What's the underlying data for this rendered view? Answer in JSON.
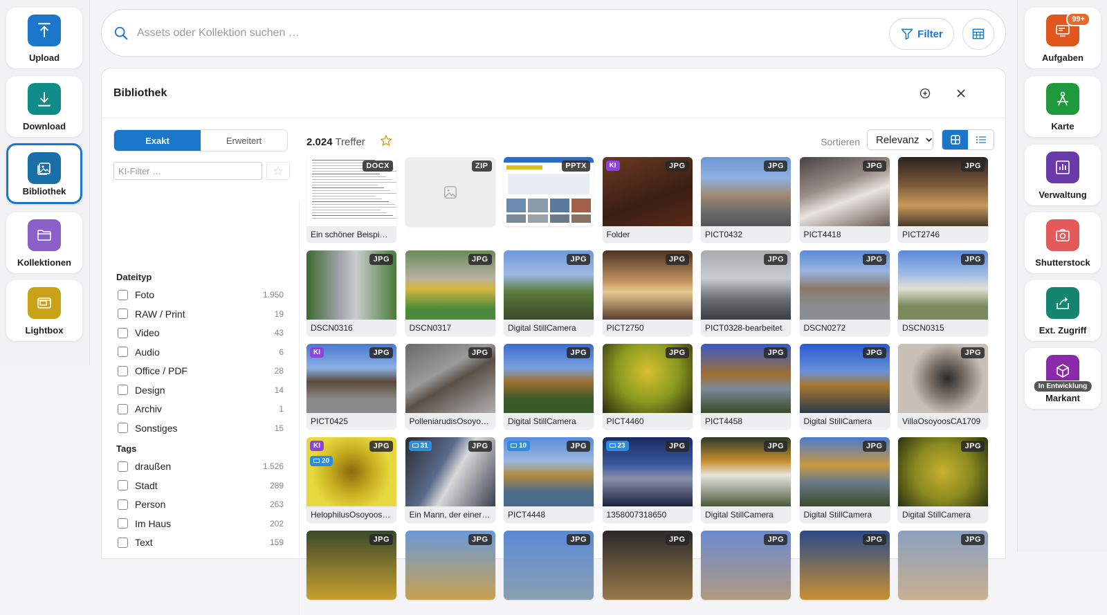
{
  "left_rail": [
    {
      "label": "Upload",
      "icon": "upload-icon",
      "color": "#1a76c9"
    },
    {
      "label": "Download",
      "icon": "download-icon",
      "color": "#0f8b8a"
    },
    {
      "label": "Bibliothek",
      "icon": "library-icon",
      "color": "#1a6fa8",
      "active": true
    },
    {
      "label": "Kollektionen",
      "icon": "folder-icon",
      "color": "#8b5fc7"
    },
    {
      "label": "Lightbox",
      "icon": "lightbox-icon",
      "color": "#c9a317"
    }
  ],
  "right_rail": [
    {
      "label": "Aufgaben",
      "icon": "tasks-icon",
      "color": "#e0561c",
      "badge": "99+"
    },
    {
      "label": "Karte",
      "icon": "map-icon",
      "color": "#1e9a3c"
    },
    {
      "label": "Verwaltung",
      "icon": "chart-icon",
      "color": "#6a3aa8"
    },
    {
      "label": "Shutterstock",
      "icon": "camera-icon",
      "color": "#e45a5a"
    },
    {
      "label": "Ext. Zugriff",
      "icon": "share-icon",
      "color": "#14856e"
    },
    {
      "label": "Markant",
      "icon": "cube-icon",
      "color": "#8a2aa8",
      "badge": "In Entwicklung"
    }
  ],
  "search": {
    "placeholder": "Assets oder Kollektion suchen …",
    "filter_label": "Filter"
  },
  "panel": {
    "title": "Bibliothek"
  },
  "filter": {
    "mode_exact": "Exakt",
    "mode_extended": "Erweitert",
    "ki_placeholder": "KI-Filter …",
    "filetype_title": "Dateityp",
    "filetypes": [
      {
        "label": "Foto",
        "count": "1.950"
      },
      {
        "label": "RAW / Print",
        "count": "19"
      },
      {
        "label": "Video",
        "count": "43"
      },
      {
        "label": "Audio",
        "count": "6"
      },
      {
        "label": "Office / PDF",
        "count": "28"
      },
      {
        "label": "Design",
        "count": "14"
      },
      {
        "label": "Archiv",
        "count": "1"
      },
      {
        "label": "Sonstiges",
        "count": "15"
      }
    ],
    "tags_title": "Tags",
    "tags": [
      {
        "label": "draußen",
        "count": "1.526"
      },
      {
        "label": "Stadt",
        "count": "289"
      },
      {
        "label": "Person",
        "count": "263"
      },
      {
        "label": "Im Haus",
        "count": "202"
      },
      {
        "label": "Text",
        "count": "159"
      }
    ]
  },
  "results": {
    "count": "2.024",
    "label": "Treffer",
    "sort_label": "Sortieren",
    "sort_value": "Relevanz"
  },
  "assets": [
    {
      "name": "Ein schöner Beispie…",
      "type": "DOCX",
      "bg": "doc"
    },
    {
      "name": "",
      "type": "ZIP",
      "bg": "zip"
    },
    {
      "name": "",
      "type": "PPTX",
      "bg": "pptx"
    },
    {
      "name": "Folder",
      "type": "JPG",
      "bg": "linear-gradient(160deg,#6b3a22,#3a1f14 60%,#5a2a1a)",
      "ki": "KI"
    },
    {
      "name": "PICT0432",
      "type": "JPG",
      "bg": "linear-gradient(180deg,#6d96d4 0%,#8fb0e0 30%,#a08a70 55%,#6a6a6a 80%,#555 100%)"
    },
    {
      "name": "PICT4418",
      "type": "JPG",
      "bg": "linear-gradient(160deg,#4a4244,#9a8e88 40%,#e8e4e0 60%,#6a5a54)"
    },
    {
      "name": "PICT2746",
      "type": "JPG",
      "bg": "linear-gradient(180deg,#2a2220,#7a5a3a 40%,#c89a5a 70%,#4a3a2a)"
    },
    {
      "name": "DSCN0316",
      "type": "JPG",
      "bg": "linear-gradient(90deg,#3e6a2e,#9aa0a4 35%,#c8ccce 55%,#4a7a3a)"
    },
    {
      "name": "DSCN0317",
      "type": "JPG",
      "bg": "linear-gradient(180deg,#6a8a5a,#b8b0a0 40%,#d4b840 55%,#4a8a3a 85%)"
    },
    {
      "name": "Digital StillCamera",
      "type": "JPG",
      "bg": "linear-gradient(180deg,#6e9ad8,#9ab8e0 35%,#5a7a3a 60%,#3a4a2a)"
    },
    {
      "name": "PICT2750",
      "type": "JPG",
      "bg": "linear-gradient(180deg,#4a3424,#c49460 45%,#e8c890 60%,#5a4030)"
    },
    {
      "name": "PICT0328-bearbeitet",
      "type": "JPG",
      "bg": "linear-gradient(180deg,#a8acb0,#c8ccd0 40%,#6a6e72 70%,#3a3e42)"
    },
    {
      "name": "DSCN0272",
      "type": "JPG",
      "bg": "linear-gradient(180deg,#5a8ad8,#9ab4e0 30%,#8a7a6a 55%,#8a8e90 80%)"
    },
    {
      "name": "DSCN0315",
      "type": "JPG",
      "bg": "linear-gradient(180deg,#5a8ad8,#a0bce4 35%,#e4e0d8 55%,#7a8a5a 80%)"
    },
    {
      "name": "PICT0425",
      "type": "JPG",
      "bg": "linear-gradient(180deg,#4a7ad0,#8ab0e4 35%,#5a4a3a 55%,#8a8a8a 80%)",
      "ki": "KI"
    },
    {
      "name": "PolleniarudisOsoyo…",
      "type": "JPG",
      "bg": "linear-gradient(150deg,#6a6a6a,#9a9a9a 40%,#5a5048 55%,#b0b0b0)"
    },
    {
      "name": "Digital StillCamera",
      "type": "JPG",
      "bg": "linear-gradient(180deg,#3a6ad0,#7aa0dc 35%,#a07030 55%,#3a5a2a 80%)"
    },
    {
      "name": "PICT4460",
      "type": "JPG",
      "bg": "radial-gradient(circle at 50% 40%,#d8c030,#8a9a20 50%,#2a2a10)"
    },
    {
      "name": "PICT4458",
      "type": "JPG",
      "bg": "linear-gradient(180deg,#3a5ac8,#a07030 45%,#7a8a9a 65%,#3a4a2a)"
    },
    {
      "name": "Digital StillCamera",
      "type": "JPG",
      "bg": "linear-gradient(180deg,#2a5ad0,#6a90d8 40%,#a87830 60%,#2a3a4a)"
    },
    {
      "name": "VillaOsoyoosCA1709",
      "type": "JPG",
      "bg": "radial-gradient(circle at 55% 50%,#2a2a2a,#7a7068 30%,#c8c0b8 60%)"
    },
    {
      "name": "HelophilusOsoyoos…",
      "type": "JPG",
      "bg": "radial-gradient(circle at 50% 50%,#8a6a10,#c8b020 40%,#e8d840 70%)",
      "ki": "KI",
      "tag": "20"
    },
    {
      "name": "Ein Mann, der einer…",
      "type": "JPG",
      "bg": "linear-gradient(120deg,#2a2a30,#5a6a8a 40%,#d8d8d8 55%,#3a4050)",
      "tag": "31"
    },
    {
      "name": "PICT4448",
      "type": "JPG",
      "bg": "linear-gradient(180deg,#5a8ad8,#9ab8e0 35%,#b08a40 55%,#4a6a8a 80%)",
      "tag": "10"
    },
    {
      "name": "1358007318650",
      "type": "JPG",
      "bg": "linear-gradient(180deg,#1a2a60,#3a5aa0 40%,#8a90a8 60%,#1a2040)",
      "tag": "23"
    },
    {
      "name": "Digital StillCamera",
      "type": "JPG",
      "bg": "linear-gradient(180deg,#2a3a2a,#c89030 35%,#e8e4e0 55%,#4a5a3a)"
    },
    {
      "name": "Digital StillCamera",
      "type": "JPG",
      "bg": "linear-gradient(180deg,#4a7ad0,#c89a40 40%,#6a7a8a 65%,#3a4a2a)"
    },
    {
      "name": "Digital StillCamera",
      "type": "JPG",
      "bg": "radial-gradient(circle at 50% 50%,#c8b030,#8a8a20 50%,#2a3010)"
    },
    {
      "name": "",
      "type": "JPG",
      "bg": "linear-gradient(180deg,#3a4a2a,#c8a030)"
    },
    {
      "name": "",
      "type": "JPG",
      "bg": "linear-gradient(180deg,#6a9ad8,#c8a050)"
    },
    {
      "name": "",
      "type": "JPG",
      "bg": "linear-gradient(180deg,#5a8ad8,#8aa0b0)"
    },
    {
      "name": "",
      "type": "JPG",
      "bg": "linear-gradient(180deg,#2a2a2a,#9a7a4a)"
    },
    {
      "name": "",
      "type": "JPG",
      "bg": "linear-gradient(180deg,#6a8ad0,#b09a80)"
    },
    {
      "name": "",
      "type": "JPG",
      "bg": "linear-gradient(180deg,#2a4a8a,#c89030)"
    },
    {
      "name": "",
      "type": "JPG",
      "bg": "linear-gradient(180deg,#8aa0c0,#c8b090)"
    }
  ]
}
